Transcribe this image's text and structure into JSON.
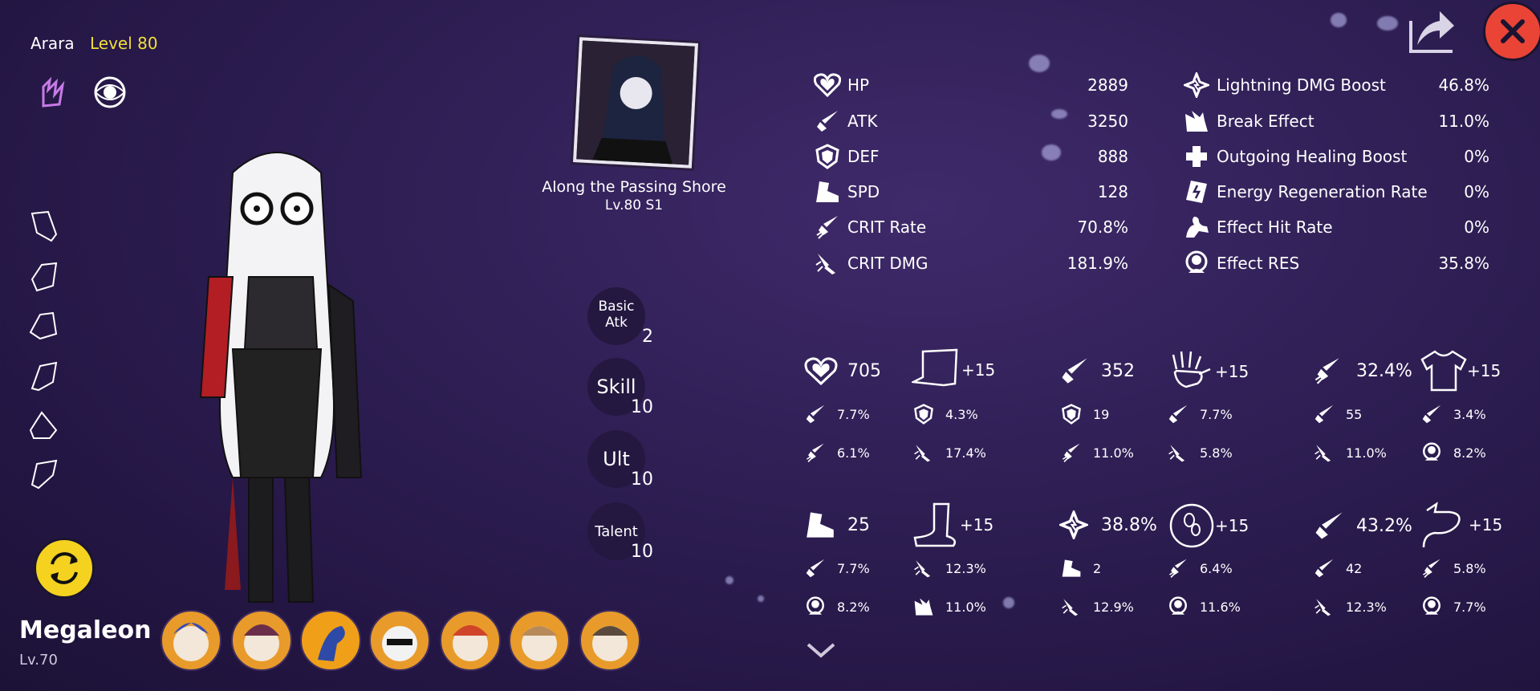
{
  "header": {
    "player_name": "Arara",
    "player_level": "Level 80"
  },
  "character": {
    "name": "Megaleon",
    "level": "Lv.70"
  },
  "light_cone": {
    "name": "Along the Passing Shore",
    "level": "Lv.80 S1"
  },
  "skills": [
    {
      "label_line1": "Basic",
      "label_line2": "Atk",
      "level": "2"
    },
    {
      "label_line1": "Skill",
      "label_line2": "",
      "level": "10"
    },
    {
      "label_line1": "Ult",
      "label_line2": "",
      "level": "10"
    },
    {
      "label_line1": "Talent",
      "label_line2": "",
      "level": "10"
    }
  ],
  "stats_left": [
    {
      "icon": "heart-icon",
      "label": "HP",
      "value": "2889"
    },
    {
      "icon": "sword-icon",
      "label": "ATK",
      "value": "3250"
    },
    {
      "icon": "shield-icon",
      "label": "DEF",
      "value": "888"
    },
    {
      "icon": "boot-icon",
      "label": "SPD",
      "value": "128"
    },
    {
      "icon": "crit-rate-icon",
      "label": "CRIT Rate",
      "value": "70.8%"
    },
    {
      "icon": "crit-dmg-icon",
      "label": "CRIT DMG",
      "value": "181.9%"
    }
  ],
  "stats_right": [
    {
      "icon": "lightning-icon",
      "label": "Lightning DMG Boost",
      "value": "46.8%"
    },
    {
      "icon": "break-icon",
      "label": "Break Effect",
      "value": "11.0%"
    },
    {
      "icon": "healing-icon",
      "label": "Outgoing Healing Boost",
      "value": "0%"
    },
    {
      "icon": "energy-icon",
      "label": "Energy Regeneration Rate",
      "value": "0%"
    },
    {
      "icon": "effect-hit-icon",
      "label": "Effect Hit Rate",
      "value": "0%"
    },
    {
      "icon": "effect-res-icon",
      "label": "Effect RES",
      "value": "35.8%"
    }
  ],
  "relics": [
    {
      "slot": "head",
      "main_value": "705",
      "level": "+15",
      "subs": [
        "7.7%",
        "4.3%",
        "6.1%",
        "17.4%"
      ]
    },
    {
      "slot": "hands",
      "main_value": "352",
      "level": "+15",
      "subs": [
        "19",
        "7.7%",
        "11.0%",
        "5.8%"
      ]
    },
    {
      "slot": "body",
      "main_value": "32.4%",
      "level": "+15",
      "subs": [
        "55",
        "3.4%",
        "11.0%",
        "8.2%"
      ]
    },
    {
      "slot": "feet",
      "main_value": "25",
      "level": "+15",
      "subs": [
        "7.7%",
        "12.3%",
        "8.2%",
        "11.0%"
      ]
    },
    {
      "slot": "sphere",
      "main_value": "38.8%",
      "level": "+15",
      "subs": [
        "2",
        "6.4%",
        "12.9%",
        "11.6%"
      ]
    },
    {
      "slot": "rope",
      "main_value": "43.2%",
      "level": "+15",
      "subs": [
        "42",
        "5.8%",
        "12.3%",
        "7.7%"
      ]
    }
  ],
  "colors": {
    "accent_yellow": "#f3de3b",
    "close_red": "#ea4436",
    "bg_purple": "#2f1f55"
  }
}
